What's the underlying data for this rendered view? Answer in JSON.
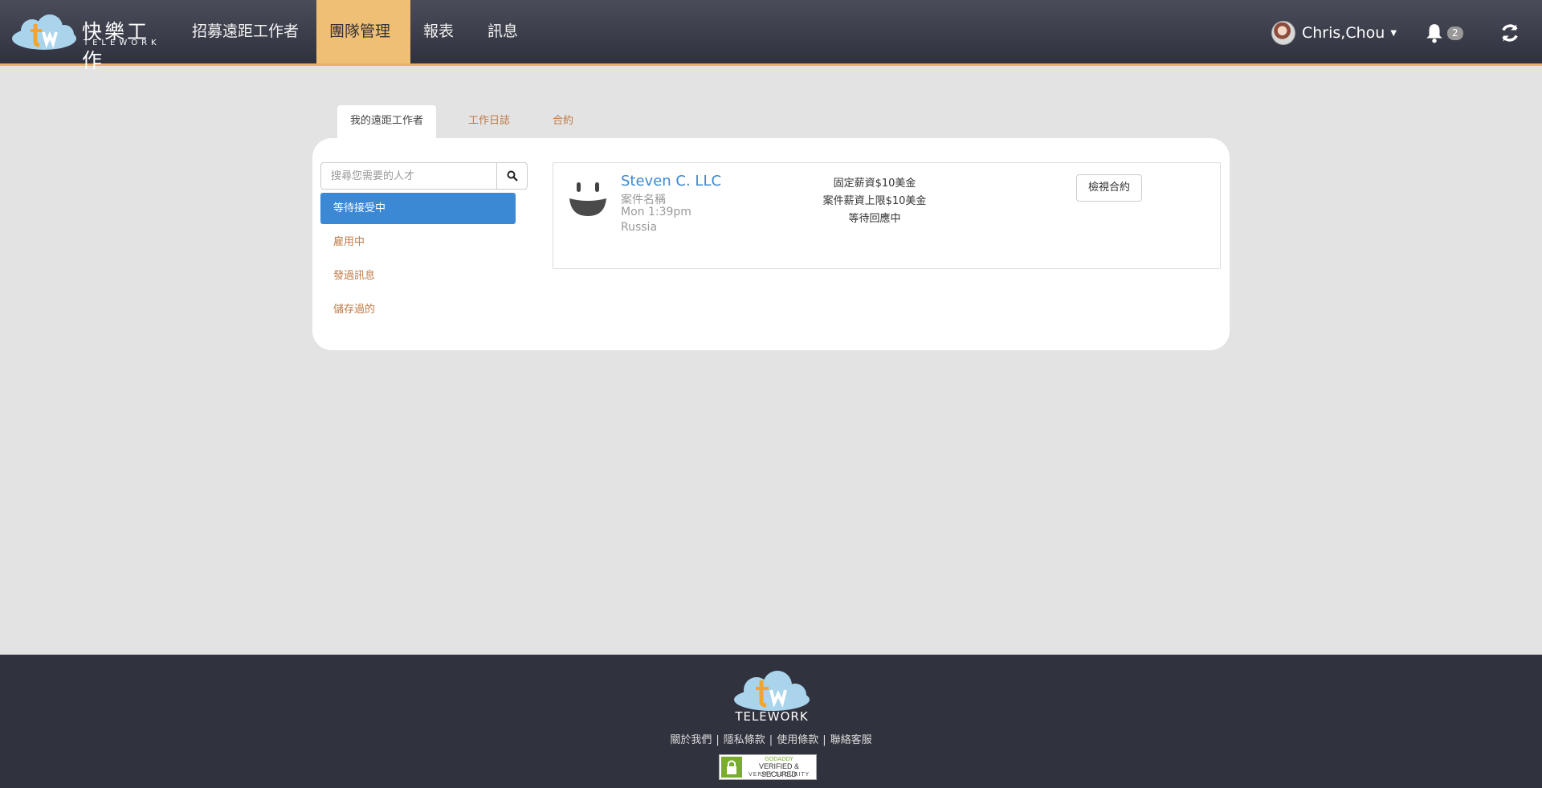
{
  "header": {
    "logo_cn": "快樂工作",
    "logo_en": "TELEWORK",
    "nav": [
      "招募遠距工作者",
      "團隊管理",
      "報表",
      "訊息"
    ],
    "active_nav": "團隊管理",
    "user_name": "Chris,Chou",
    "notification_count": "2"
  },
  "tabs": [
    "我的遠距工作者",
    "工作日誌",
    "合約"
  ],
  "active_tab": "我的遠距工作者",
  "search": {
    "placeholder": "搜尋您需要的人才"
  },
  "filters": [
    "等待接受中",
    "雇用中",
    "發過訊息",
    "儲存過的"
  ],
  "active_filter": "等待接受中",
  "card": {
    "name": "Steven C. LLC",
    "project": "案件名稱",
    "time": "Mon 1:39pm",
    "location": "Russia",
    "fixed_pay": "固定薪資$10美金",
    "pay_cap": "案件薪資上限$10美金",
    "status": "等待回應中",
    "view_button": "檢視合約"
  },
  "footer": {
    "logo_text": "TELEWORK",
    "links": [
      "關於我們",
      "隱私條款",
      "使用條款",
      "聯絡客服"
    ],
    "seal_brand": "GODADDY",
    "seal_main": "VERIFIED & SECURED",
    "seal_sub": "VERIFY SECURITY"
  },
  "colors": {
    "nav_bg": "#3d404c",
    "nav_active": "#f0bf76",
    "link_orange": "#c07a47",
    "primary_blue": "#3b88d4",
    "page_bg": "#e3e3e3",
    "footer_bg": "#30323e"
  }
}
